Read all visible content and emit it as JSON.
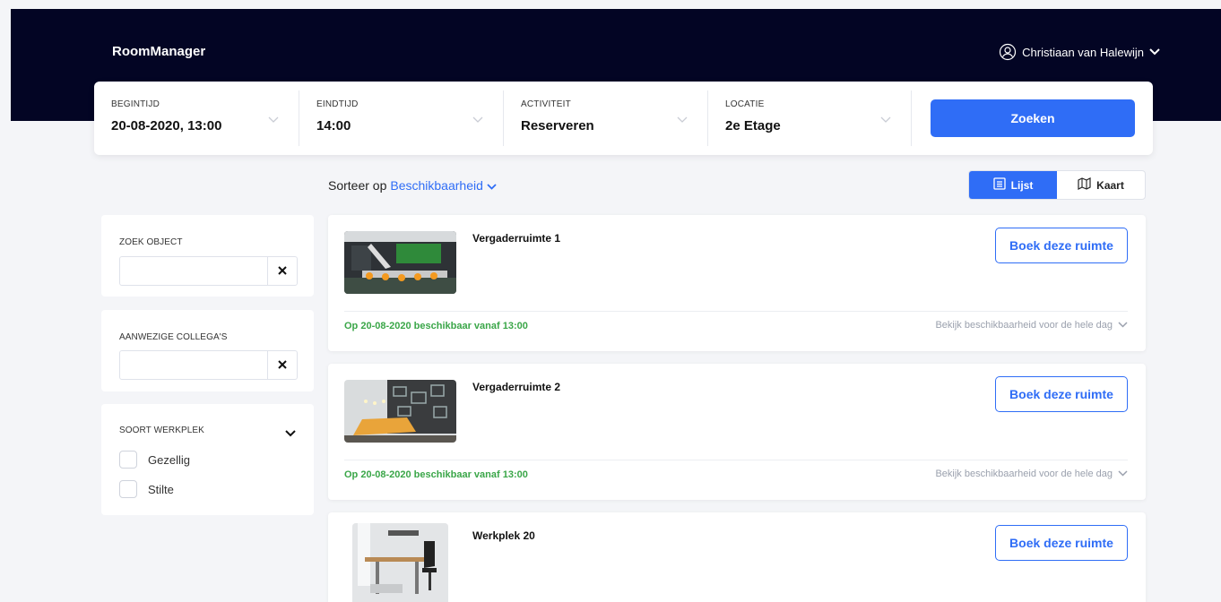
{
  "app": {
    "brand": "RoomManager"
  },
  "user": {
    "name": "Christiaan van Halewijn"
  },
  "search": {
    "fields": [
      {
        "label": "BEGINTIJD",
        "value": "20-08-2020, 13:00"
      },
      {
        "label": "EINDTIJD",
        "value": "14:00"
      },
      {
        "label": "ACTIVITEIT",
        "value": "Reserveren"
      },
      {
        "label": "LOCATIE",
        "value": "2e Etage"
      }
    ],
    "button": "Zoeken"
  },
  "sort": {
    "prefix": "Sorteer op",
    "value": "Beschikbaarheid"
  },
  "view_toggle": {
    "list": "Lijst",
    "map": "Kaart",
    "active": "list"
  },
  "filters": {
    "object": {
      "label": "ZOEK OBJECT",
      "value": ""
    },
    "colleagues": {
      "label": "AANWEZIGE COLLEGA'S",
      "value": ""
    },
    "type": {
      "label": "SOORT WERKPLEK",
      "options": [
        "Gezellig",
        "Stilte"
      ]
    }
  },
  "rooms": [
    {
      "name": "Vergaderruimte 1",
      "book": "Boek deze ruimte",
      "availability": "Op 20-08-2020 beschikbaar vanaf 13:00",
      "day_link": "Bekijk beschikbaarheid voor de hele dag"
    },
    {
      "name": "Vergaderruimte 2",
      "book": "Boek deze ruimte",
      "availability": "Op 20-08-2020 beschikbaar vanaf 13:00",
      "day_link": "Bekijk beschikbaarheid voor de hele dag"
    },
    {
      "name": "Werkplek 20",
      "book": "Boek deze ruimte"
    }
  ],
  "colors": {
    "navy": "#030524",
    "accent": "#2f6df6",
    "available": "#3aa648"
  },
  "icons": [
    "user-circle-icon",
    "chevron-down-icon",
    "list-icon",
    "map-icon",
    "close-icon"
  ]
}
